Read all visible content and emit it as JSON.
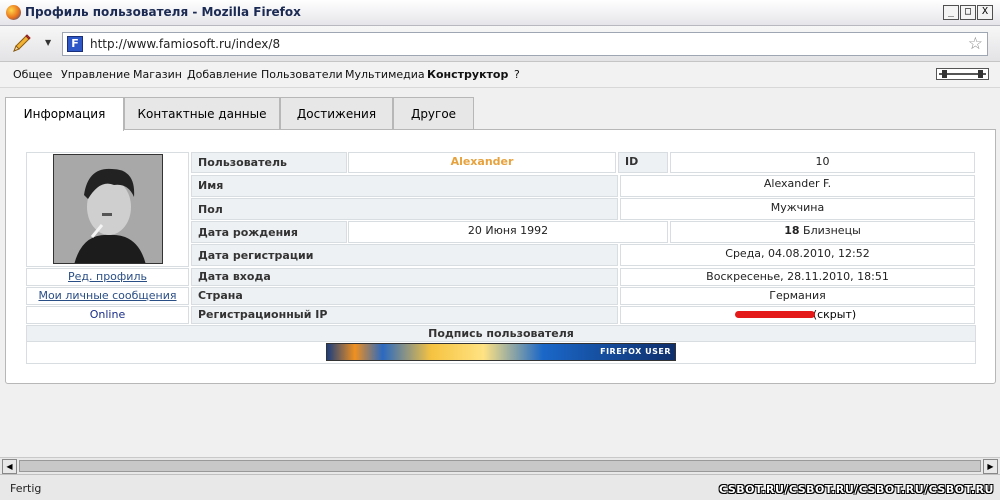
{
  "window": {
    "title": "Профиль пользователя - Mozilla Firefox",
    "btn_min": "_",
    "btn_max": "□",
    "btn_close": "X"
  },
  "navbar": {
    "url": "http://www.famiosoft.ru/index/8",
    "site_icon_letter": "F",
    "star": "☆",
    "dropdown": "▼"
  },
  "menu": {
    "items": [
      "Общее",
      "Управление",
      "Магазин",
      "Добавление",
      "Пользователи",
      "Мультимедиа",
      "Конструктор",
      "?"
    ]
  },
  "tabs": [
    "Информация",
    "Контактные данные",
    "Достижения",
    "Другое"
  ],
  "profile": {
    "left_links": {
      "edit": "Ред. профиль",
      "messages": "Мои личные сообщения",
      "status": "Online"
    },
    "rows": {
      "user_label": "Пользователь",
      "user_value": "Alexander",
      "id_label": "ID",
      "id_value": "10",
      "name_label": "Имя",
      "name_value": "Alexander F.",
      "gender_label": "Пол",
      "gender_value": "Мужчина",
      "birth_label": "Дата рождения",
      "birth_value": "20 Июня 1992",
      "zodiac_number": "18",
      "zodiac_text": " Близнецы",
      "reg_label": "Дата регистрации",
      "reg_value": "Среда, 04.08.2010, 12:52",
      "login_label": "Дата входа",
      "login_value": "Воскресенье, 28.11.2010, 18:51",
      "country_label": "Страна",
      "country_value": "Германия",
      "ip_label": "Регистрационный IP",
      "ip_value": "(скрыт)"
    },
    "signature_label": "Подпись пользователя",
    "banner_text": "FIREFOX USER"
  },
  "status": {
    "text": "Fertig",
    "watermark": "CSBOT.RU/CSBOT.RU/CSBOT.RU/CSBOT.RU"
  }
}
